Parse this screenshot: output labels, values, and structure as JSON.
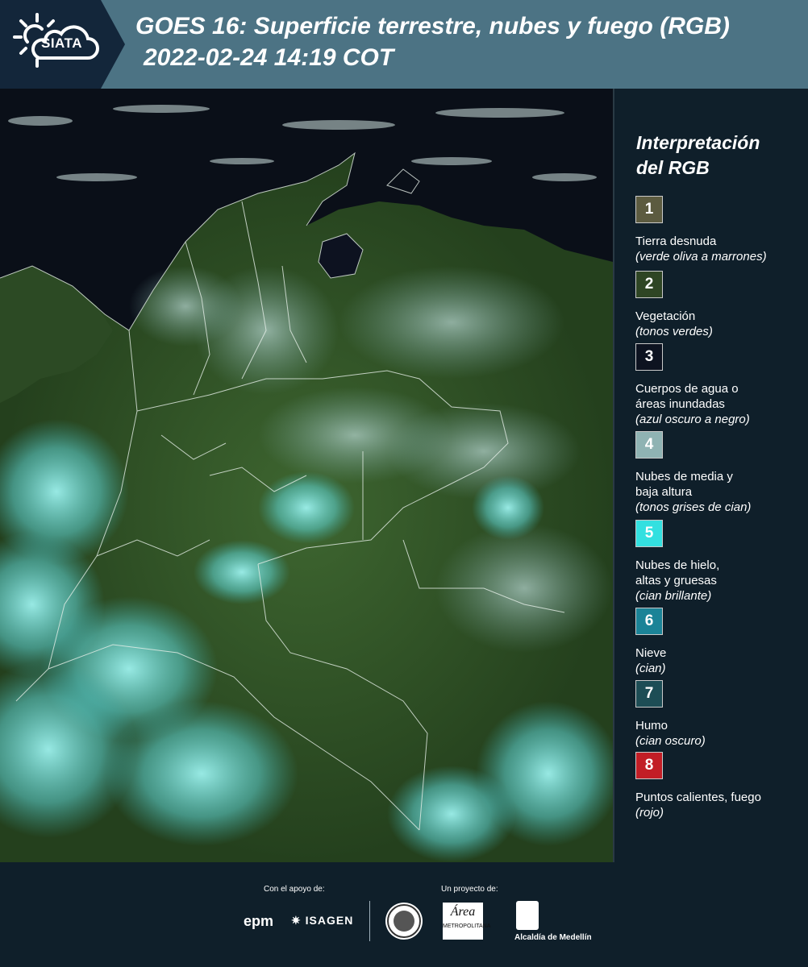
{
  "header": {
    "logo": "SIATA",
    "title": "GOES 16: Superficie terrestre, nubes y fuego (RGB)",
    "subtitle": "2022-02-24 14:19 COT"
  },
  "legend": {
    "title_line1": "Interpretación",
    "title_line2": "del RGB",
    "items": [
      {
        "num": "1",
        "label": "Tierra desnuda",
        "label2": "",
        "sub": "(verde oliva a marrones)",
        "color": "#5c5b40"
      },
      {
        "num": "2",
        "label": "Vegetación",
        "label2": "",
        "sub": "(tonos verdes)",
        "color": "#2e4524"
      },
      {
        "num": "3",
        "label": "Cuerpos de agua o",
        "label2": "áreas inundadas",
        "sub": "(azul oscuro a negro)",
        "color": "#0d1320"
      },
      {
        "num": "4",
        "label": "Nubes de media y",
        "label2": "baja altura",
        "sub": "(tonos grises de cian)",
        "color": "#8fb3b3"
      },
      {
        "num": "5",
        "label": "Nubes de hielo,",
        "label2": "altas y gruesas",
        "sub": "(cian brillante)",
        "color": "#33e0e0"
      },
      {
        "num": "6",
        "label": "Nieve",
        "label2": "",
        "sub": "(cian)",
        "color": "#1b8397"
      },
      {
        "num": "7",
        "label": "Humo",
        "label2": "",
        "sub": "(cian oscuro)",
        "color": "#1d4d55"
      },
      {
        "num": "8",
        "label": "Puntos calientes, fuego",
        "label2": "",
        "sub": "(rojo)",
        "color": "#c21e26"
      }
    ]
  },
  "footer": {
    "support_label": "Con el apoyo de:",
    "project_label": "Un proyecto de:",
    "epm": "epm",
    "isagen": "ISAGEN",
    "area": "Área",
    "area_sub": "METROPOLITANA",
    "alcaldia": "Alcaldía de Medellín"
  }
}
